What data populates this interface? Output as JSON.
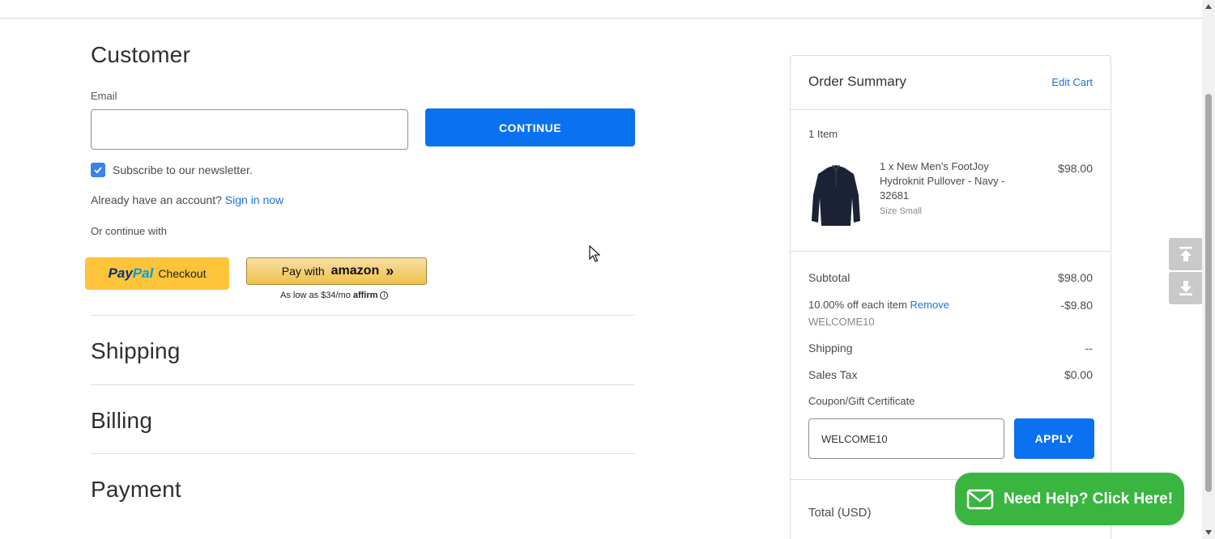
{
  "customer": {
    "title": "Customer",
    "email_label": "Email",
    "email_value": "",
    "continue_label": "CONTINUE",
    "newsletter_label": "Subscribe to our newsletter.",
    "newsletter_checked": true,
    "account_prompt": "Already have an account?",
    "sign_in_label": "Sign in now",
    "or_continue": "Or continue with",
    "paypal": {
      "brand_p1": "Pay",
      "brand_p2": "Pal",
      "checkout": "Checkout"
    },
    "amazon": {
      "prefix": "Pay with",
      "brand": "amazon",
      "chevrons": "»"
    },
    "affirm": {
      "text": "As low as $34/mo",
      "brand": "affirm",
      "info": "i"
    }
  },
  "sections": {
    "shipping": "Shipping",
    "billing": "Billing",
    "payment": "Payment"
  },
  "summary": {
    "title": "Order Summary",
    "edit_cart": "Edit Cart",
    "item_count": "1 Item",
    "item": {
      "name": "1 x New Men's FootJoy Hydroknit Pullover - Navy - 32681",
      "size": "Size Small",
      "price": "$98.00"
    },
    "subtotal_label": "Subtotal",
    "subtotal_value": "$98.00",
    "discount_label": "10.00% off each item",
    "discount_remove": "Remove",
    "discount_code": "WELCOME10",
    "discount_value": "-$9.80",
    "shipping_label": "Shipping",
    "shipping_value": "--",
    "tax_label": "Sales Tax",
    "tax_value": "$0.00",
    "coupon_link": "Coupon/Gift Certificate",
    "coupon_value": "WELCOME10",
    "apply_label": "APPLY",
    "total_label": "Total (USD)"
  },
  "help": {
    "label": "Need Help? Click Here!"
  },
  "colors": {
    "primary": "#0a72f0",
    "link": "#1a73d9",
    "help": "#3ab53f",
    "paypal": "#ffc439"
  }
}
